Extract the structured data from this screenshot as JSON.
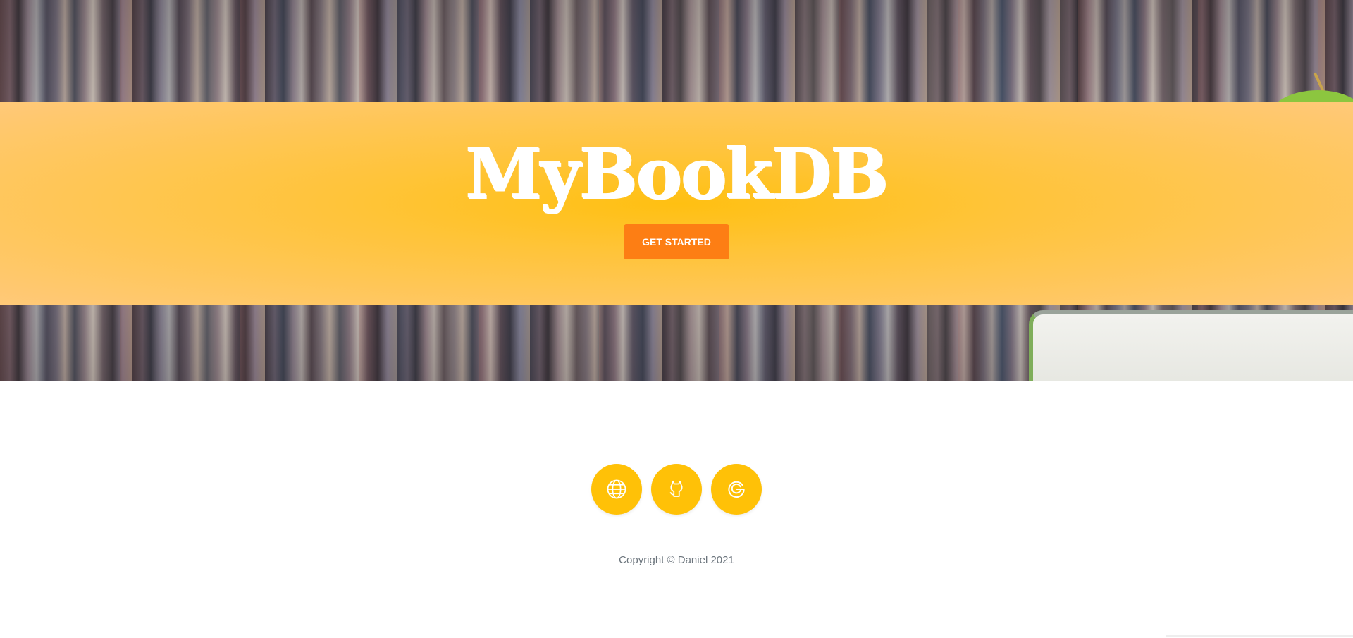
{
  "brand": {
    "title": "MyBookDB"
  },
  "hero": {
    "cta_label": "GET STARTED"
  },
  "social": {
    "items": [
      {
        "icon": "globe-icon"
      },
      {
        "icon": "github-icon"
      },
      {
        "icon": "google-icon"
      }
    ]
  },
  "footer": {
    "copyright": "Copyright  © Daniel 2021"
  },
  "colors": {
    "banner": "#ffc012",
    "cta": "#fd7e14",
    "social": "#ffc107",
    "copyright_text": "#6c757d"
  }
}
